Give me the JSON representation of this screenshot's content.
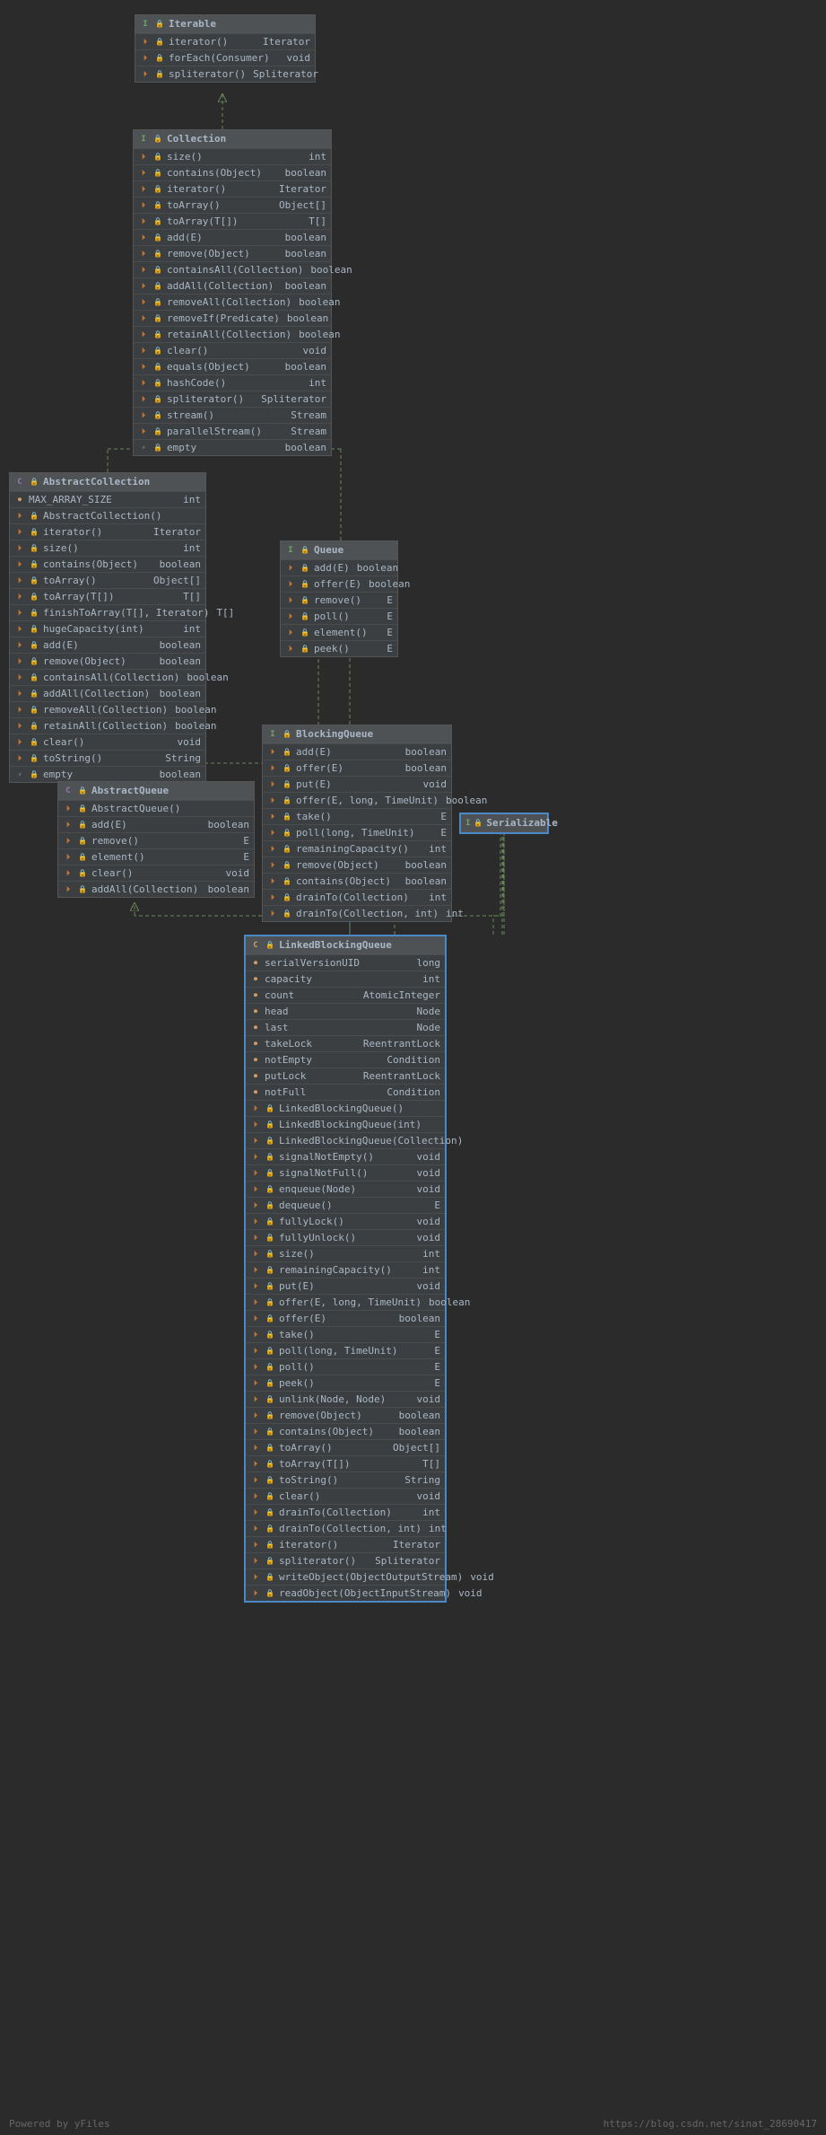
{
  "watermark": "https://blog.csdn.net/sinat_28690417",
  "powered": "Powered by yFiles",
  "boxes": {
    "iterable": {
      "title": "Iterable",
      "rows": [
        {
          "n": "iterator()",
          "t": "Iterator<T>"
        },
        {
          "n": "forEach(Consumer<? super T>)",
          "t": "void"
        },
        {
          "n": "spliterator()",
          "t": "Spliterator<T>"
        }
      ]
    },
    "collection": {
      "title": "Collection",
      "rows": [
        {
          "n": "size()",
          "t": "int"
        },
        {
          "n": "contains(Object)",
          "t": "boolean"
        },
        {
          "n": "iterator()",
          "t": "Iterator<E>"
        },
        {
          "n": "toArray()",
          "t": "Object[]"
        },
        {
          "n": "toArray(T[])",
          "t": "T[]"
        },
        {
          "n": "add(E)",
          "t": "boolean"
        },
        {
          "n": "remove(Object)",
          "t": "boolean"
        },
        {
          "n": "containsAll(Collection<?>)",
          "t": "boolean"
        },
        {
          "n": "addAll(Collection<? extends E>)",
          "t": "boolean"
        },
        {
          "n": "removeAll(Collection<?>)",
          "t": "boolean"
        },
        {
          "n": "removeIf(Predicate<? super E>)",
          "t": "boolean"
        },
        {
          "n": "retainAll(Collection<?>)",
          "t": "boolean"
        },
        {
          "n": "clear()",
          "t": "void"
        },
        {
          "n": "equals(Object)",
          "t": "boolean"
        },
        {
          "n": "hashCode()",
          "t": "int"
        },
        {
          "n": "spliterator()",
          "t": "Spliterator<E>"
        },
        {
          "n": "stream()",
          "t": "Stream<E>"
        },
        {
          "n": "parallelStream()",
          "t": "Stream<E>"
        },
        {
          "n": "empty",
          "t": "boolean",
          "prop": true
        }
      ]
    },
    "abscoll": {
      "title": "AbstractCollection",
      "fields": [
        {
          "n": "MAX_ARRAY_SIZE",
          "t": "int"
        }
      ],
      "ctors": [
        {
          "n": "AbstractCollection()"
        }
      ],
      "rows": [
        {
          "n": "iterator()",
          "t": "Iterator<E>"
        },
        {
          "n": "size()",
          "t": "int"
        },
        {
          "n": "contains(Object)",
          "t": "boolean"
        },
        {
          "n": "toArray()",
          "t": "Object[]"
        },
        {
          "n": "toArray(T[])",
          "t": "T[]"
        },
        {
          "n": "finishToArray(T[], Iterator<?>)",
          "t": "T[]"
        },
        {
          "n": "hugeCapacity(int)",
          "t": "int"
        },
        {
          "n": "add(E)",
          "t": "boolean"
        },
        {
          "n": "remove(Object)",
          "t": "boolean"
        },
        {
          "n": "containsAll(Collection<?>)",
          "t": "boolean"
        },
        {
          "n": "addAll(Collection<? extends E>)",
          "t": "boolean"
        },
        {
          "n": "removeAll(Collection<?>)",
          "t": "boolean"
        },
        {
          "n": "retainAll(Collection<?>)",
          "t": "boolean"
        },
        {
          "n": "clear()",
          "t": "void"
        },
        {
          "n": "toString()",
          "t": "String"
        },
        {
          "n": "empty",
          "t": "boolean",
          "prop": true
        }
      ]
    },
    "queue": {
      "title": "Queue",
      "rows": [
        {
          "n": "add(E)",
          "t": "boolean"
        },
        {
          "n": "offer(E)",
          "t": "boolean"
        },
        {
          "n": "remove()",
          "t": "E"
        },
        {
          "n": "poll()",
          "t": "E"
        },
        {
          "n": "element()",
          "t": "E"
        },
        {
          "n": "peek()",
          "t": "E"
        }
      ]
    },
    "absqueue": {
      "title": "AbstractQueue",
      "ctors": [
        {
          "n": "AbstractQueue()"
        }
      ],
      "rows": [
        {
          "n": "add(E)",
          "t": "boolean"
        },
        {
          "n": "remove()",
          "t": "E"
        },
        {
          "n": "element()",
          "t": "E"
        },
        {
          "n": "clear()",
          "t": "void"
        },
        {
          "n": "addAll(Collection<? extends E>)",
          "t": "boolean"
        }
      ]
    },
    "blockq": {
      "title": "BlockingQueue",
      "rows": [
        {
          "n": "add(E)",
          "t": "boolean"
        },
        {
          "n": "offer(E)",
          "t": "boolean"
        },
        {
          "n": "put(E)",
          "t": "void"
        },
        {
          "n": "offer(E, long, TimeUnit)",
          "t": "boolean"
        },
        {
          "n": "take()",
          "t": "E"
        },
        {
          "n": "poll(long, TimeUnit)",
          "t": "E"
        },
        {
          "n": "remainingCapacity()",
          "t": "int"
        },
        {
          "n": "remove(Object)",
          "t": "boolean"
        },
        {
          "n": "contains(Object)",
          "t": "boolean"
        },
        {
          "n": "drainTo(Collection<? super E>)",
          "t": "int"
        },
        {
          "n": "drainTo(Collection<? super E>, int)",
          "t": "int"
        }
      ]
    },
    "serial": {
      "title": "Serializable"
    },
    "lbq": {
      "title": "LinkedBlockingQueue",
      "fields": [
        {
          "n": "serialVersionUID",
          "t": "long"
        },
        {
          "n": "capacity",
          "t": "int"
        },
        {
          "n": "count",
          "t": "AtomicInteger"
        },
        {
          "n": "head",
          "t": "Node<E>"
        },
        {
          "n": "last",
          "t": "Node<E>"
        },
        {
          "n": "takeLock",
          "t": "ReentrantLock"
        },
        {
          "n": "notEmpty",
          "t": "Condition"
        },
        {
          "n": "putLock",
          "t": "ReentrantLock"
        },
        {
          "n": "notFull",
          "t": "Condition"
        }
      ],
      "ctors": [
        {
          "n": "LinkedBlockingQueue()"
        },
        {
          "n": "LinkedBlockingQueue(int)"
        },
        {
          "n": "LinkedBlockingQueue(Collection<? extends E>)"
        }
      ],
      "rows": [
        {
          "n": "signalNotEmpty()",
          "t": "void"
        },
        {
          "n": "signalNotFull()",
          "t": "void"
        },
        {
          "n": "enqueue(Node<E>)",
          "t": "void"
        },
        {
          "n": "dequeue()",
          "t": "E"
        },
        {
          "n": "fullyLock()",
          "t": "void"
        },
        {
          "n": "fullyUnlock()",
          "t": "void"
        },
        {
          "n": "size()",
          "t": "int"
        },
        {
          "n": "remainingCapacity()",
          "t": "int"
        },
        {
          "n": "put(E)",
          "t": "void"
        },
        {
          "n": "offer(E, long, TimeUnit)",
          "t": "boolean"
        },
        {
          "n": "offer(E)",
          "t": "boolean"
        },
        {
          "n": "take()",
          "t": "E"
        },
        {
          "n": "poll(long, TimeUnit)",
          "t": "E"
        },
        {
          "n": "poll()",
          "t": "E"
        },
        {
          "n": "peek()",
          "t": "E"
        },
        {
          "n": "unlink(Node<E>, Node<E>)",
          "t": "void"
        },
        {
          "n": "remove(Object)",
          "t": "boolean"
        },
        {
          "n": "contains(Object)",
          "t": "boolean"
        },
        {
          "n": "toArray()",
          "t": "Object[]"
        },
        {
          "n": "toArray(T[])",
          "t": "T[]"
        },
        {
          "n": "toString()",
          "t": "String"
        },
        {
          "n": "clear()",
          "t": "void"
        },
        {
          "n": "drainTo(Collection<? super E>)",
          "t": "int"
        },
        {
          "n": "drainTo(Collection<? super E>, int)",
          "t": "int"
        },
        {
          "n": "iterator()",
          "t": "Iterator<E>"
        },
        {
          "n": "spliterator()",
          "t": "Spliterator<E>"
        },
        {
          "n": "writeObject(ObjectOutputStream)",
          "t": "void"
        },
        {
          "n": "readObject(ObjectInputStream)",
          "t": "void"
        }
      ]
    }
  }
}
